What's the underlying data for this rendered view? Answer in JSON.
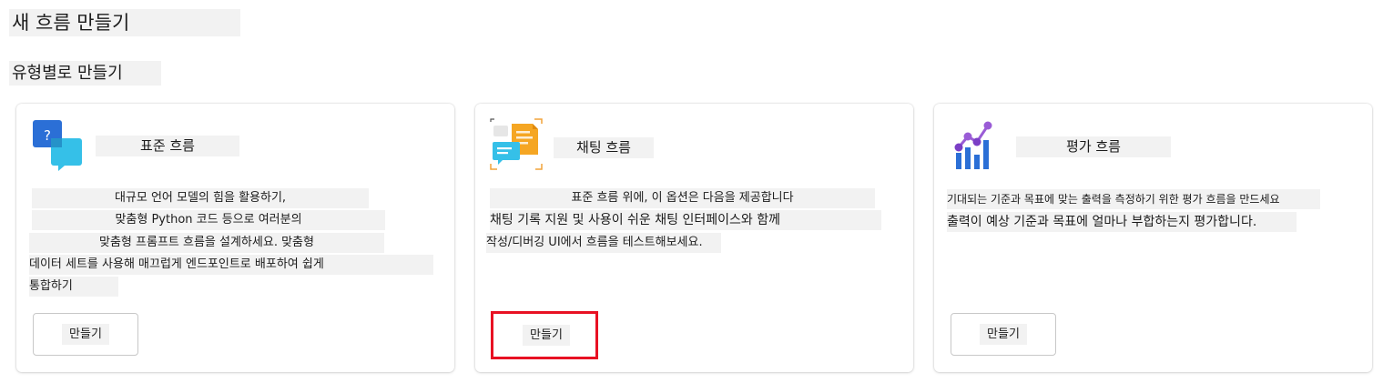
{
  "page": {
    "title": "새 흐름 만들기",
    "section_title": "유형별로 만들기"
  },
  "cards": [
    {
      "icon": "chat-question-icon",
      "title": "표준 흐름",
      "description_lines": [
        "대규모 언어 모델의 힘을 활용하기,",
        "맞춤형 Python 코드 등으로 여러분의",
        "맞춤형 프롬프트 흐름을 설계하세요. 맞춤형",
        "데이터 세트를 사용해 매끄럽게 엔드포인트로 배포하여 쉽게",
        "통합하기"
      ],
      "button_label": "만들기"
    },
    {
      "icon": "chat-document-icon",
      "title": "채팅 흐름",
      "description_lines": [
        "표준 흐름 위에, 이 옵션은 다음을 제공합니다",
        "채팅 기록 지원 및 사용이 쉬운 채팅 인터페이스와 함께",
        "작성/디버깅 UI에서 흐름을 테스트해보세요."
      ],
      "button_label": "만들기",
      "highlight_color": "#e81123"
    },
    {
      "icon": "evaluation-chart-icon",
      "title": "평가 흐름",
      "description_lines": [
        "기대되는 기준과 목표에 맞는 출력을 측정하기 위한 평가 흐름을 만드세요",
        "출력이 예상 기준과 목표에 얼마나 부합하는지 평가합니다."
      ],
      "button_label": "만들기"
    }
  ]
}
